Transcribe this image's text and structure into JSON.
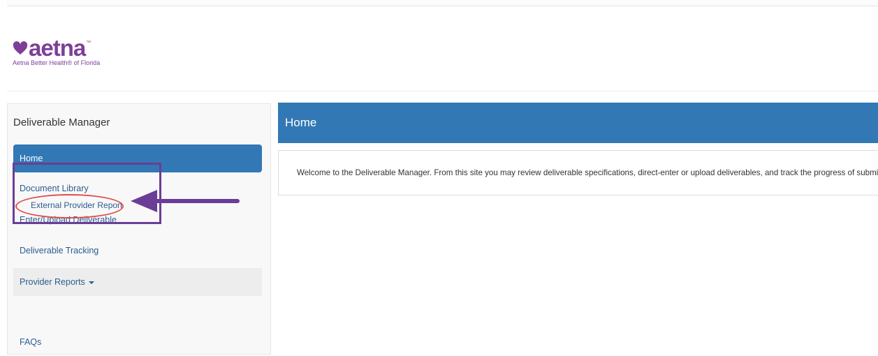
{
  "brand": {
    "logo_text": "aetna",
    "logo_tm": "™",
    "subtitle": "Aetna Better Health® of Florida",
    "color": "#7d3f98"
  },
  "sidebar": {
    "title": "Deliverable Manager",
    "items": [
      {
        "label": "Home",
        "active": true
      },
      {
        "label": "Document Library"
      },
      {
        "label": "Enter/Upload Deliverable"
      },
      {
        "label": "Deliverable Tracking"
      },
      {
        "label": "Provider Reports",
        "dropdown": true,
        "submenu": [
          {
            "label": "External Provider Report"
          }
        ]
      },
      {
        "label": "FAQs"
      }
    ]
  },
  "main": {
    "title": "Home",
    "welcome_text": "Welcome to the Deliverable Manager. From this site you may review deliverable specifications, direct-enter or upload deliverables, and track the progress of submissions."
  },
  "colors": {
    "accent": "#3278b4",
    "annotation_box": "#6a3d96",
    "annotation_oval": "#e24a4a"
  },
  "icons": {
    "logo_mark": "heart-icon",
    "dropdown": "caret-down-icon",
    "annotation": "arrow-left-icon"
  }
}
